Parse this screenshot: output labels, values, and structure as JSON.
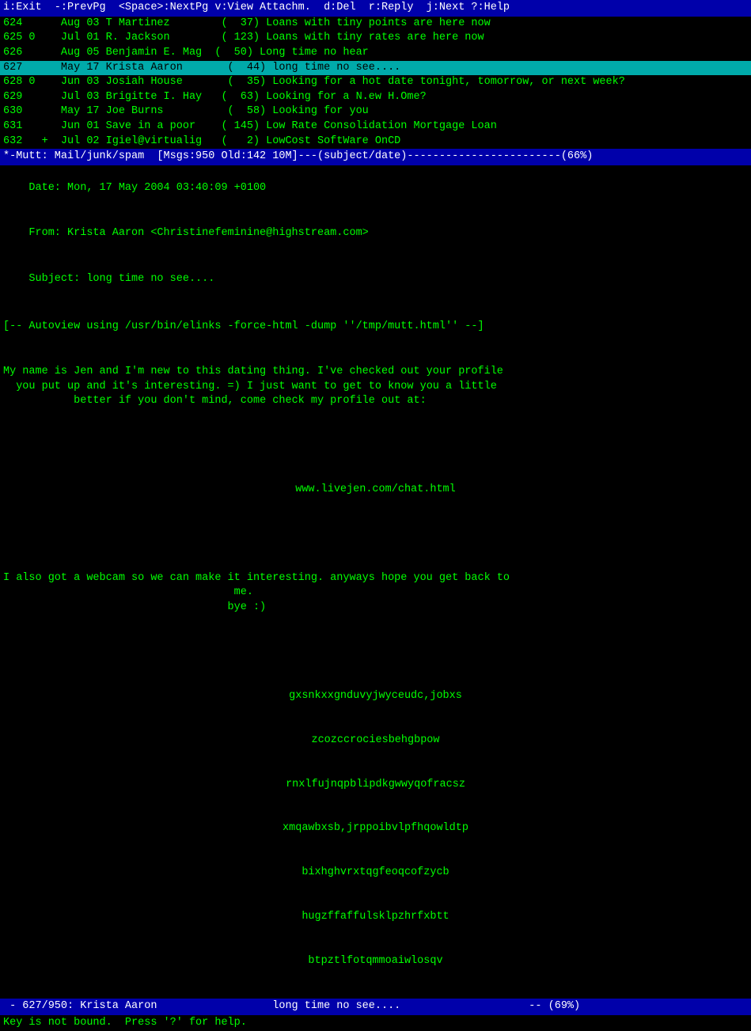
{
  "topbar": {
    "text": "i:Exit  -:PrevPg  <Space>:NextPg v:View Attachm.  d:Del  r:Reply  j:Next ?:Help"
  },
  "emails": [
    {
      "id": "624",
      "flag": " ",
      "date": "Aug 03",
      "sender": "T Martinez",
      "size": "( 37)",
      "subject": "Loans with tiny points are here now",
      "selected": false
    },
    {
      "id": "625",
      "flag": "0",
      "date": "Jul 01",
      "sender": "R. Jackson",
      "size": "(123)",
      "subject": "Loans with tiny rates are here now",
      "selected": false
    },
    {
      "id": "626",
      "flag": " ",
      "date": "Aug 05",
      "sender": "Benjamin E. Mag",
      "size": "( 50)",
      "subject": "Long time no hear",
      "selected": false
    },
    {
      "id": "627",
      "flag": " ",
      "date": "May 17",
      "sender": "Krista Aaron",
      "size": "( 44)",
      "subject": "long time no see....",
      "selected": true
    },
    {
      "id": "628",
      "flag": "0",
      "date": "Jun 03",
      "sender": "Josiah House",
      "size": "( 35)",
      "subject": "Looking for a hot date tonight, tomorrow, or next week?",
      "selected": false
    },
    {
      "id": "629",
      "flag": " ",
      "date": "Jul 03",
      "sender": "Brigitte I. Hay",
      "size": "( 63)",
      "subject": "Looking for a N.ew H.Ome?",
      "selected": false
    },
    {
      "id": "630",
      "flag": " ",
      "date": "May 17",
      "sender": "Joe Burns",
      "size": "( 58)",
      "subject": "Looking for you",
      "selected": false
    },
    {
      "id": "631",
      "flag": " ",
      "date": "Jun 01",
      "sender": "Save in a poor",
      "size": "(145)",
      "subject": "Low Rate Consolidation Mortgage Loan",
      "selected": false
    },
    {
      "id": "632",
      "flag": "+",
      "date": "Jul 02",
      "sender": "Igiel@virtualig",
      "size": "(  2)",
      "subject": "LowCost SoftWare OnCD",
      "selected": false
    }
  ],
  "mutt_status": "*-Mutt: Mail/junk/spam  [Msgs:950 Old:142 10M]---(subject/date)------------------------(66%)",
  "email_headers": {
    "date": "Date: Mon, 17 May 2004 03:40:09 +0100",
    "from": "From: Krista Aaron <Christinefeminine@highstream.com>",
    "subject": "Subject: long time no see...."
  },
  "autoview_cmd": "[-- Autoview using /usr/bin/elinks -force-html -dump ''/tmp/mutt.html'' --]",
  "email_body": {
    "para1": "My name is Jen and I'm new to this dating thing. I've checked out your profile\n  you put up and it's interesting. =) I just want to get to know you a little\n           better if you don't mind, come check my profile out at:",
    "url": "www.livejen.com/chat.html",
    "para2": "I also got a webcam so we can make it interesting. anyways hope you get back to\n                                    me.\n                                   bye :)",
    "scramble1": "gxsnkxxgnduvyjwyceudc,jobxs",
    "scramble2": "zcozccrociesbehgbpow",
    "scramble3": "rnxlfujnqpblipdkgwwyqofracsz",
    "scramble4": "xmqawbxsb,jrppoibvlpfhqowldtp",
    "scramble5": "bixhghvrxtqgfeoqcofzycb",
    "scramble6": "hugzffaffulsklpzhrfxbtt",
    "scramble7": "btpztlfotqmmoaiwlosqv"
  },
  "bottom_status": " - 627/950: Krista Aaron                  long time no see....                    -- (69%)",
  "bottom_hint": "Key is not bound.  Press '?' for help."
}
